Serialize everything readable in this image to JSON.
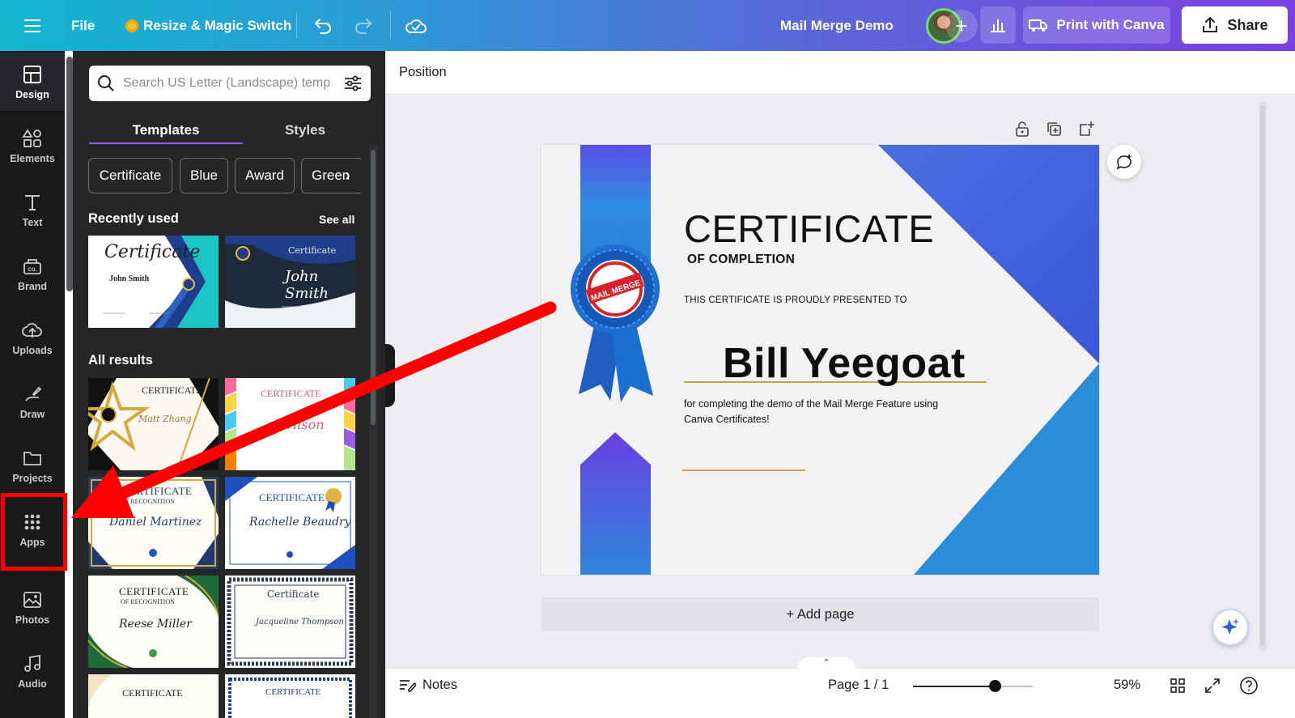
{
  "topbar": {
    "menu_icon": "hamburger-icon",
    "file_label": "File",
    "resize_label": "Resize & Magic Switch",
    "doc_title": "Mail Merge Demo",
    "add_collaborator": "+",
    "print_label": "Print with Canva",
    "share_label": "Share",
    "brand_gradient": [
      "#12b6cf",
      "#7b3fe0"
    ]
  },
  "rail": {
    "items": [
      {
        "label": "Design",
        "icon": "design-icon"
      },
      {
        "label": "Elements",
        "icon": "elements-icon"
      },
      {
        "label": "Text",
        "icon": "text-icon"
      },
      {
        "label": "Brand",
        "icon": "brand-icon"
      },
      {
        "label": "Uploads",
        "icon": "uploads-icon"
      },
      {
        "label": "Draw",
        "icon": "draw-icon"
      },
      {
        "label": "Projects",
        "icon": "folder-icon"
      },
      {
        "label": "Apps",
        "icon": "apps-grid-icon"
      },
      {
        "label": "Photos",
        "icon": "photos-icon"
      },
      {
        "label": "Audio",
        "icon": "music-note-icon"
      }
    ]
  },
  "panel": {
    "search_placeholder": "Search US Letter (Landscape) temp",
    "tabs": [
      {
        "label": "Templates"
      },
      {
        "label": "Styles"
      }
    ],
    "chips": [
      {
        "label": "Certificate"
      },
      {
        "label": "Blue"
      },
      {
        "label": "Award"
      },
      {
        "label": "Green"
      }
    ],
    "recently_used": "Recently used",
    "see_all": "See all",
    "all_results": "All results",
    "thumbs": {
      "r1": {
        "script": "Certificate",
        "name": "John Smith"
      },
      "r2": {
        "title": "Certificate",
        "script": "John Smith"
      },
      "a1": {
        "title": "CERTIFICATE",
        "script": "Matt Zhang"
      },
      "a2": {
        "title": "CERTIFICATE",
        "script": "Wilson"
      },
      "a3": {
        "title": "CERTIFICATE",
        "sub": "OF RECOGNITION",
        "script": "Daniel Martinez"
      },
      "a4": {
        "title": "CERTIFICATE",
        "script": "Rachelle Beaudry"
      },
      "a5": {
        "title": "CERTIFICATE",
        "sub": "OF RECOGNITION",
        "script": "Reese Miller"
      },
      "a6": {
        "title": "Certificate",
        "script": "Jacqueline Thompson"
      },
      "a7": {
        "title": "CERTIFICATE"
      },
      "a8": {
        "title": "CERTIFICATE"
      }
    }
  },
  "workspace": {
    "position_label": "Position",
    "add_page": "+ Add page",
    "certificate": {
      "title": "CERTIFICATE",
      "subtitle": "OF COMPLETION",
      "presented": "THIS CERTIFICATE IS PROUDLY PRESENTED TO",
      "recipient": "Bill Yeegoat",
      "description": "for completing the demo of the Mail Merge Feature using Canva Certificates!",
      "seal_text": "MAIL MERGE",
      "accent_blue": "#4a5fe0",
      "accent_gold": "#c9a24a"
    }
  },
  "bottombar": {
    "notes_label": "Notes",
    "page_label": "Page 1 / 1",
    "zoom_label": "59%",
    "zoom_value": 0.68
  }
}
